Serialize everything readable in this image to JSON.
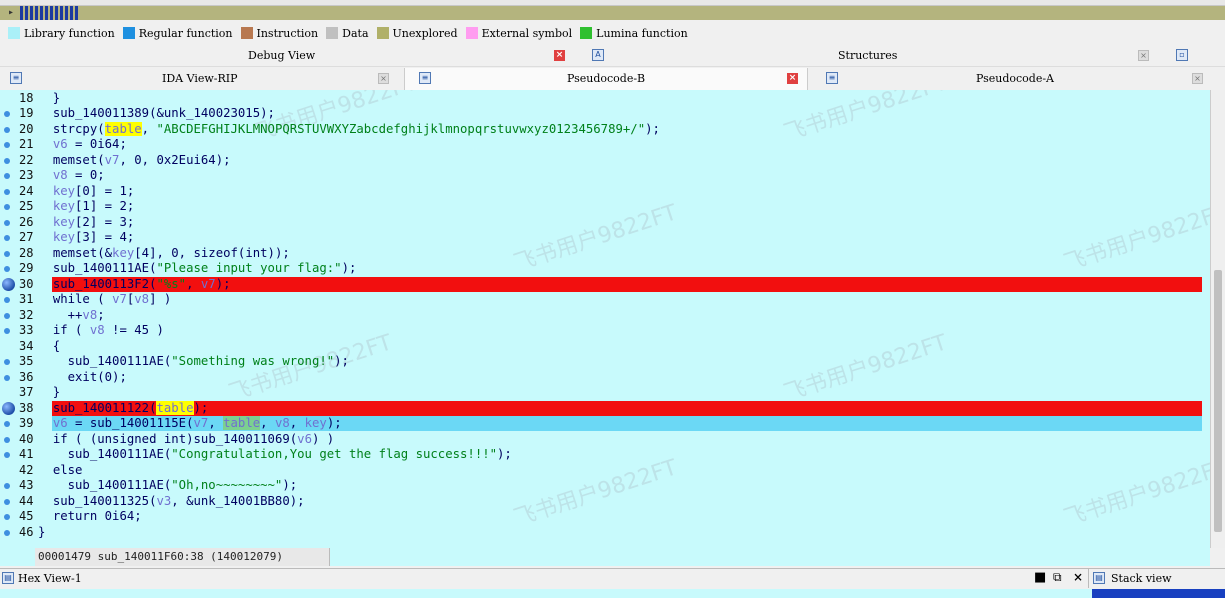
{
  "legend": [
    {
      "label": "Library function",
      "color": "#aaf0f8"
    },
    {
      "label": "Regular function",
      "color": "#1e90e0"
    },
    {
      "label": "Instruction",
      "color": "#b87850"
    },
    {
      "label": "Data",
      "color": "#c0c0c0"
    },
    {
      "label": "Unexplored",
      "color": "#b0b068"
    },
    {
      "label": "External symbol",
      "color": "#ff9cf0"
    },
    {
      "label": "Lumina function",
      "color": "#30c030"
    }
  ],
  "tabs_top": {
    "debug_view": "Debug View",
    "structures": "Structures"
  },
  "tabs_views": {
    "ida_view": "IDA View-RIP",
    "pseudocode_b": "Pseudocode-B",
    "pseudocode_a": "Pseudocode-A"
  },
  "status": "00001479 sub_140011F60:38 (140012079)",
  "bottom": {
    "hex_view": "Hex View-1",
    "stack_view": "Stack view"
  },
  "watermark": "飞书用户9822FT",
  "code_lines": [
    {
      "n": "18",
      "code": "  }"
    },
    {
      "n": "19",
      "code": "  sub_140011389(&unk_140023015);"
    },
    {
      "n": "20",
      "code": "  strcpy(table, \"ABCDEFGHIJKLMNOPQRSTUVWXYZabcdefghijklmnopqrstuvwxyz0123456789+/\");"
    },
    {
      "n": "21",
      "code": "  v6 = 0i64;"
    },
    {
      "n": "22",
      "code": "  memset(v7, 0, 0x2Eui64);"
    },
    {
      "n": "23",
      "code": "  v8 = 0;"
    },
    {
      "n": "24",
      "code": "  key[0] = 1;"
    },
    {
      "n": "25",
      "code": "  key[1] = 2;"
    },
    {
      "n": "26",
      "code": "  key[2] = 3;"
    },
    {
      "n": "27",
      "code": "  key[3] = 4;"
    },
    {
      "n": "28",
      "code": "  memset(&key[4], 0, sizeof(int));"
    },
    {
      "n": "29",
      "code": "  sub_1400111AE(\"Please input your flag:\");"
    },
    {
      "n": "30",
      "code": "  sub_1400113F2(\"%s\", v7);"
    },
    {
      "n": "31",
      "code": "  while ( v7[v8] )"
    },
    {
      "n": "32",
      "code": "    ++v8;"
    },
    {
      "n": "33",
      "code": "  if ( v8 != 45 )"
    },
    {
      "n": "34",
      "code": "  {"
    },
    {
      "n": "35",
      "code": "    sub_1400111AE(\"Something was wrong!\");"
    },
    {
      "n": "36",
      "code": "    exit(0);"
    },
    {
      "n": "37",
      "code": "  }"
    },
    {
      "n": "38",
      "code": "  sub_140011122(table);"
    },
    {
      "n": "39",
      "code": "  v6 = sub_14001115E(v7, table, v8, key);"
    },
    {
      "n": "40",
      "code": "  if ( (unsigned int)sub_140011069(v6) )"
    },
    {
      "n": "41",
      "code": "    sub_1400111AE(\"Congratulation,You get the flag success!!!\");"
    },
    {
      "n": "42",
      "code": "  else"
    },
    {
      "n": "43",
      "code": "    sub_1400111AE(\"Oh,no~~~~~~~~\");"
    },
    {
      "n": "44",
      "code": "  sub_140011325(v3, &unk_14001BB80);"
    },
    {
      "n": "45",
      "code": "  return 0i64;"
    },
    {
      "n": "46",
      "code": "}"
    }
  ]
}
